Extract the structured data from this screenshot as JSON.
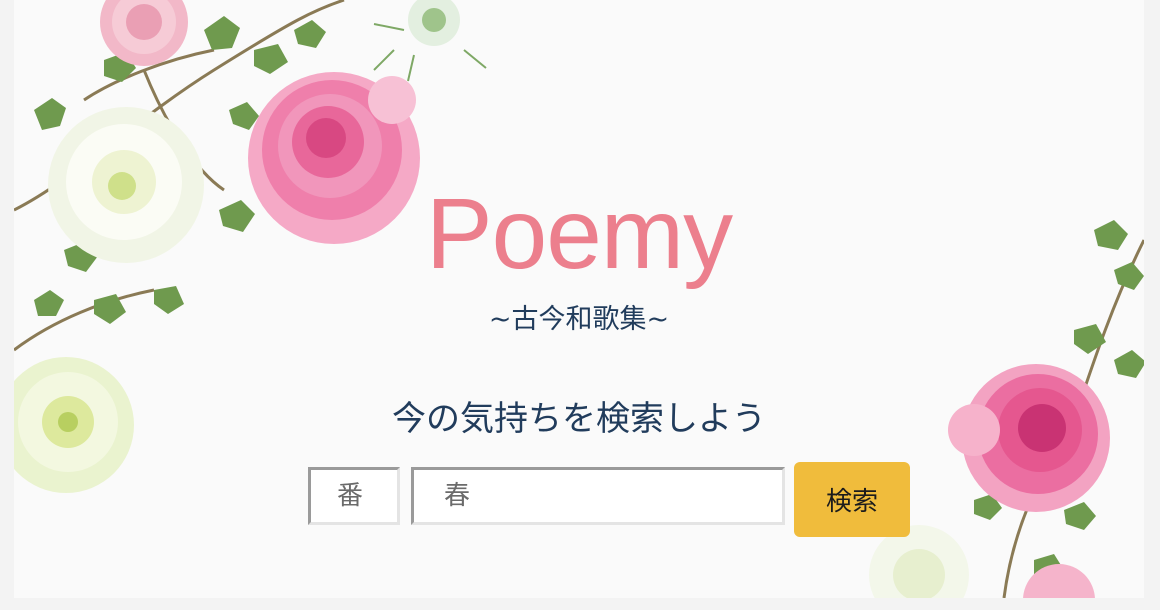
{
  "hero": {
    "title": "Poemy",
    "subtitle": "~古今和歌集~",
    "prompt": "今の気持ちを検索しよう"
  },
  "search": {
    "number_placeholder": "番",
    "keyword_placeholder": "春",
    "button_label": "検索"
  },
  "colors": {
    "title": "#ec7f8d",
    "text": "#213c5c",
    "button": "#f0bc3c",
    "background": "#fafafa"
  },
  "decorations": [
    "pink-ranunculus-flower",
    "white-lisianthus-flower",
    "green-lisianthus-flower",
    "pink-carnation-flower",
    "ivy-leaves",
    "nigella-flower"
  ]
}
